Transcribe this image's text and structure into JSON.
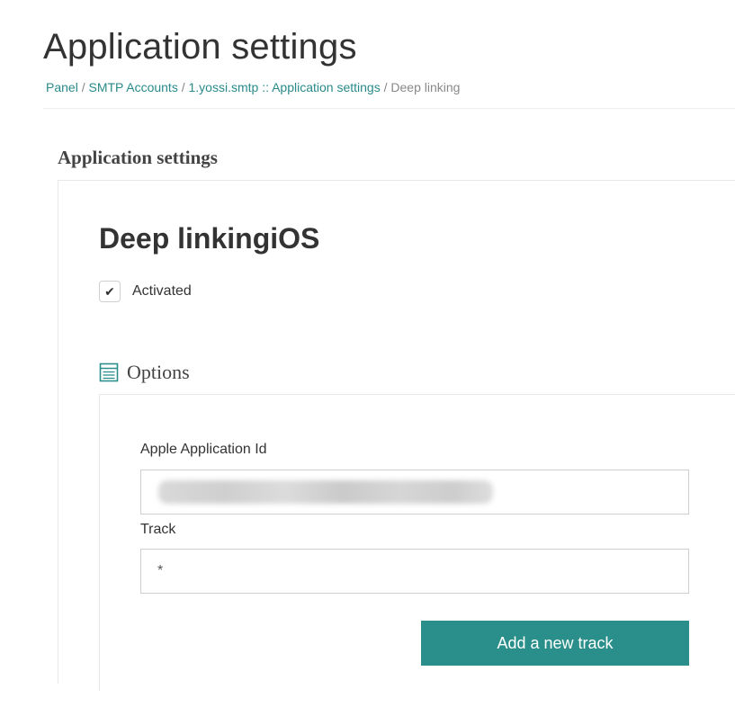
{
  "page": {
    "title": "Application settings"
  },
  "breadcrumb": {
    "items": [
      {
        "label": "Panel",
        "link": true
      },
      {
        "label": "SMTP Accounts",
        "link": true
      },
      {
        "label": "1.yossi.smtp :: Application settings",
        "link": true
      },
      {
        "label": "Deep linking",
        "link": false
      }
    ],
    "separator": " / "
  },
  "section": {
    "heading": "Application settings"
  },
  "feature": {
    "title": "Deep linkingiOS",
    "activated": {
      "label": "Activated",
      "checked": true,
      "check_glyph": "✔"
    }
  },
  "options": {
    "label": "Options",
    "icon": "table-list-icon",
    "fields": {
      "apple_app_id": {
        "label": "Apple Application Id",
        "value": ""
      },
      "track": {
        "label": "Track",
        "value": "*"
      }
    },
    "add_track_button": "Add a new track"
  },
  "colors": {
    "accent": "#2a8f8a",
    "link": "#2a8a8a"
  }
}
